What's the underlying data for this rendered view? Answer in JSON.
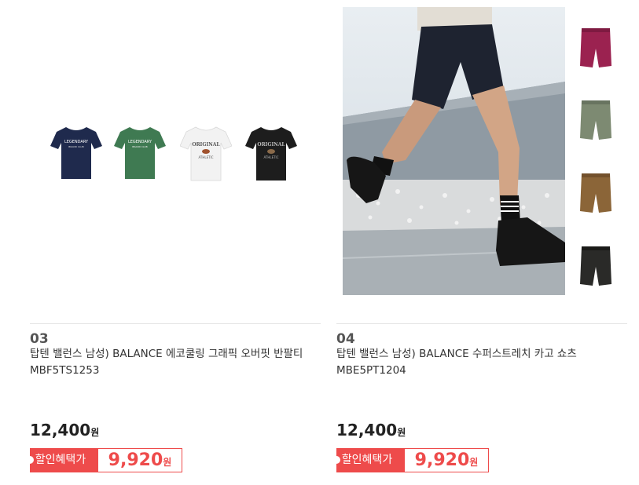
{
  "products": [
    {
      "rank": "03",
      "title": "탑텐 밸런스 남성) BALANCE 에코쿨링 그래픽 오버핏 반팔티 MBF5TS1253",
      "price": "12,400",
      "price_unit": "원",
      "discount_label": "할인혜택가",
      "discount_price": "9,920",
      "discount_unit": "원",
      "image_colors": [
        "#1f2a4d",
        "#3f7a52",
        "#f2f2f2",
        "#1d1d1d"
      ],
      "tee_prints": [
        {
          "line1": "LEGENDARY",
          "line2": "BRAND CLUB"
        },
        {
          "line1": "LEGENDARY",
          "line2": "BRAND CLUB"
        },
        {
          "line1": "ORIGINAL",
          "line2": "ATHLETIC"
        },
        {
          "line1": "ORIGINAL",
          "line2": "ATHLETIC"
        }
      ]
    },
    {
      "rank": "04",
      "title": "탑텐 밸런스 남성) BALANCE 수퍼스트레치 카고 쇼츠 MBE5PT1204",
      "price": "12,400",
      "price_unit": "원",
      "discount_label": "할인혜택가",
      "discount_price": "9,920",
      "discount_unit": "원",
      "swatch_colors": [
        "#9b2250",
        "#7d8a72",
        "#8b6538",
        "#2a2a28"
      ]
    }
  ],
  "accent_color": "#ee4b4b"
}
